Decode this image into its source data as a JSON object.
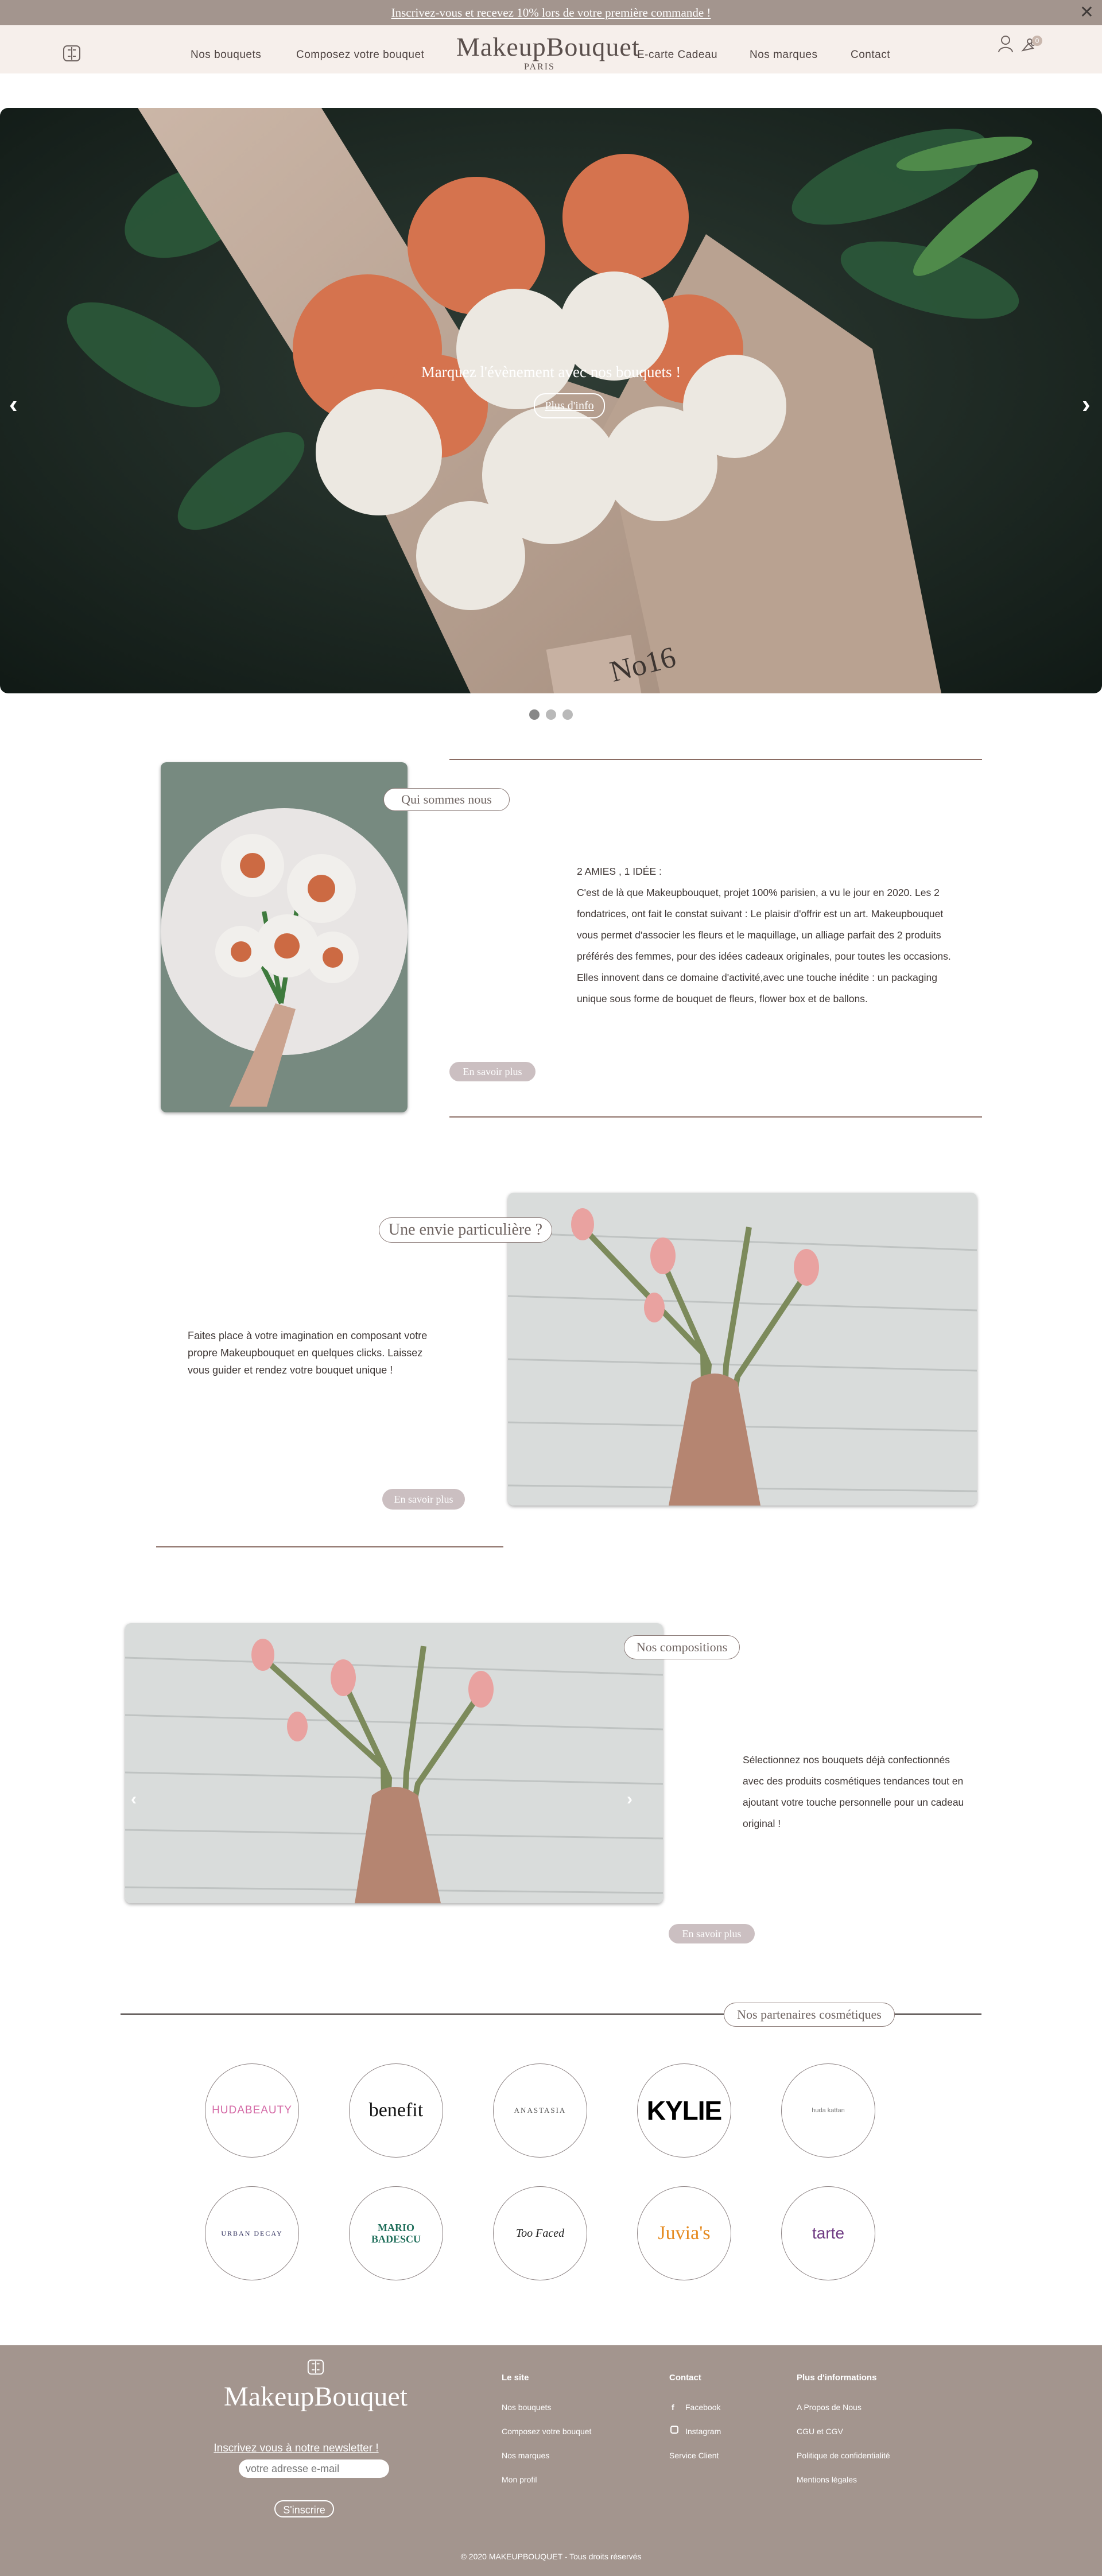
{
  "promo": {
    "text": "Inscrivez-vous et recevez 10% lors de votre première commande !",
    "close": "✕"
  },
  "header": {
    "nav_left": [
      "Nos bouquets",
      "Composez votre bouquet"
    ],
    "logo": "MakeupBouquet",
    "logo_sub": "PARIS",
    "nav_right": [
      "E-carte Cadeau",
      "Nos marques",
      "Contact"
    ],
    "cart_count": "0"
  },
  "hero": {
    "caption": "Marquez l'évènement avec nos bouquets !",
    "button": "Plus d'info",
    "wrap_label": "No16",
    "prev": "‹",
    "next": "›",
    "slides": 3,
    "active_slide": 1
  },
  "about": {
    "title": "Qui sommes nous",
    "heading": "2 AMIES , 1 IDÉE :",
    "lines": [
      "C'est de là que Makeupbouquet, projet 100% parisien, a vu le jour en 2020. Les 2",
      "fondatrices, ont fait le constat suivant : Le plaisir d'offrir est un art. Makeupbouquet",
      "vous permet d'associer les fleurs et le maquillage, un alliage parfait des 2 produits",
      "préférés des femmes, pour des idées cadeaux originales, pour toutes les occasions.",
      "Elles innovent dans ce domaine d'activité,avec une touche inédite : un packaging",
      "unique sous forme de bouquet de fleurs, flower box et de ballons."
    ],
    "button": "En savoir plus"
  },
  "custom": {
    "title": "Une envie particulière ?",
    "lines": [
      "Faites place à votre imagination en composant votre",
      "propre Makeupbouquet en quelques clicks. Laissez",
      "vous guider et rendez votre bouquet unique !"
    ],
    "button": "En savoir plus"
  },
  "compositions": {
    "title": "Nos compositions",
    "lines": [
      "Sélectionnez nos bouquets déjà confectionnés",
      "avec des produits cosmétiques tendances tout en",
      "ajoutant votre touche personnelle pour un cadeau",
      "original !"
    ],
    "button": "En savoir plus",
    "prev": "‹",
    "next": "›"
  },
  "partners": {
    "title": "Nos partenaires cosmétiques",
    "brands": [
      {
        "name": "HUDABEAUTY",
        "color": "#d46aa6"
      },
      {
        "name": "benefit",
        "color": "#111111"
      },
      {
        "name": "ANASTASIA",
        "color": "#555555"
      },
      {
        "name": "KYLIE",
        "color": "#000000"
      },
      {
        "name": "huda kattan",
        "color": "#777777"
      },
      {
        "name": "URBAN DECAY",
        "color": "#2b2b5a"
      },
      {
        "name": "MARIO BADESCU",
        "color": "#1f6e5a"
      },
      {
        "name": "Too Faced",
        "color": "#222222"
      },
      {
        "name": "Juvia's",
        "color": "#e58a1f"
      },
      {
        "name": "tarte",
        "color": "#6e3a82"
      }
    ]
  },
  "footer": {
    "logo": "MakeupBouquet",
    "newsletter": "Inscrivez vous à notre newsletter !",
    "email_placeholder": "votre adresse e-mail",
    "subscribe": "S'inscrire",
    "col1": {
      "title": "Le site",
      "links": [
        "Nos bouquets",
        "Composez votre bouquet",
        "Nos marques",
        "Mon profil"
      ]
    },
    "col2": {
      "title": "Contact",
      "links": [
        "Facebook",
        "Instagram",
        "Service Client"
      ]
    },
    "col3": {
      "title": "Plus d'informations",
      "links": [
        "A Propos de Nous",
        "CGU et CGV",
        "Politique de confidentialité",
        "Mentions légales"
      ]
    },
    "copyright": "© 2020 MAKEUPBOUQUET - Tous droits réservés"
  },
  "colors": {
    "banner": "#a3958e",
    "header_bg": "#f6efeb",
    "accent_line": "#8a6c63",
    "button_pill": "#cbbfc1"
  }
}
